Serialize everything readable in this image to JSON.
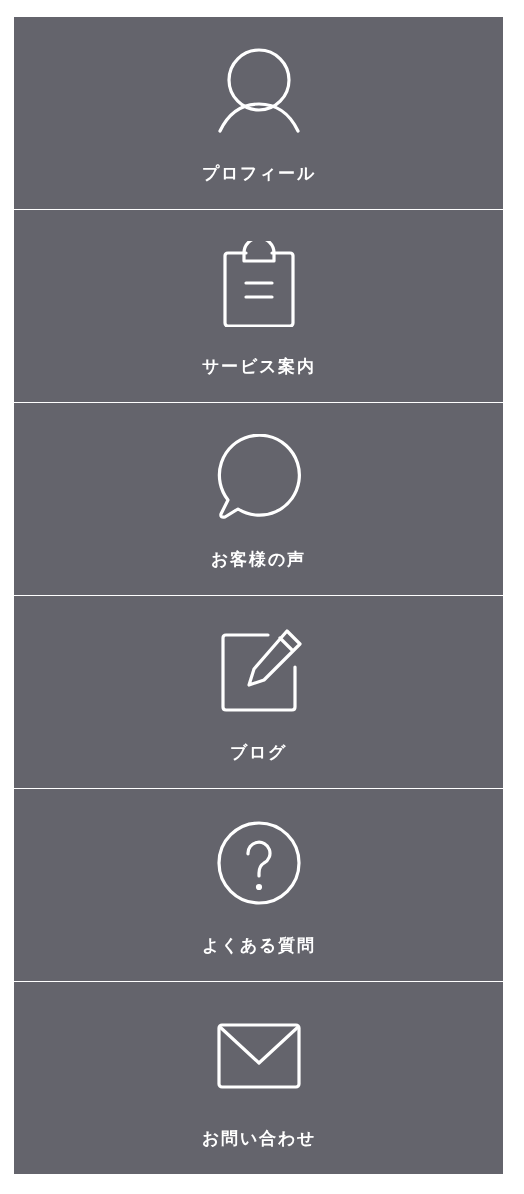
{
  "menu": [
    {
      "label": "プロフィール",
      "kind": "person"
    },
    {
      "label": "サービス案内",
      "kind": "clipboard"
    },
    {
      "label": "お客様の声",
      "kind": "chat"
    },
    {
      "label": "ブログ",
      "kind": "edit"
    },
    {
      "label": "よくある質問",
      "kind": "help"
    },
    {
      "label": "お問い合わせ",
      "kind": "mail"
    }
  ]
}
